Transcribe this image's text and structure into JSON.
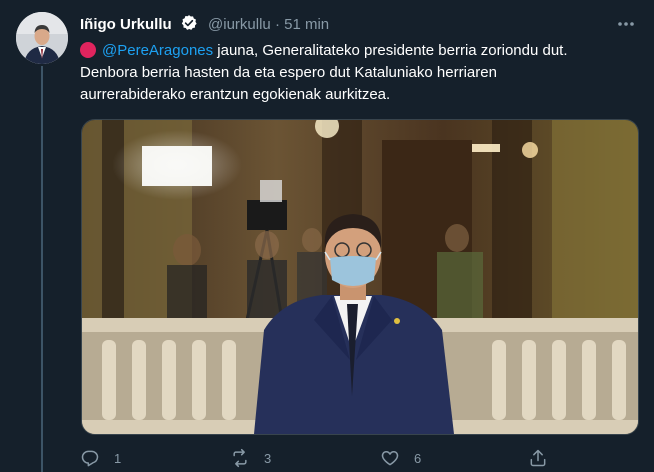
{
  "tweet": {
    "author_name": "Iñigo Urkullu",
    "handle": "@iurkullu",
    "separator": "·",
    "time": "51 min",
    "mention": "@PereAragones",
    "line1_rest": " jauna, Generalitateko presidente berria zoriondu dut.",
    "line2": "Denbora berria hasten da eta espero dut  Kataluniako herriaren",
    "line3": "aurrerabiderako erantzun egokienak aurkitzea.",
    "reply_count": "1",
    "retweet_count": "3",
    "like_count": "6"
  },
  "colors": {
    "background": "#15202b",
    "link": "#1da1f2",
    "secondary_text": "#8899a6",
    "verified_badge": "#ffffff",
    "red_circle": "#e0245e"
  },
  "icons": {
    "verified": "verified-badge-icon",
    "more": "more-options-icon",
    "red_circle": "red-circle-emoji",
    "reply": "reply-icon",
    "retweet": "retweet-icon",
    "like": "like-icon",
    "share": "share-icon"
  }
}
